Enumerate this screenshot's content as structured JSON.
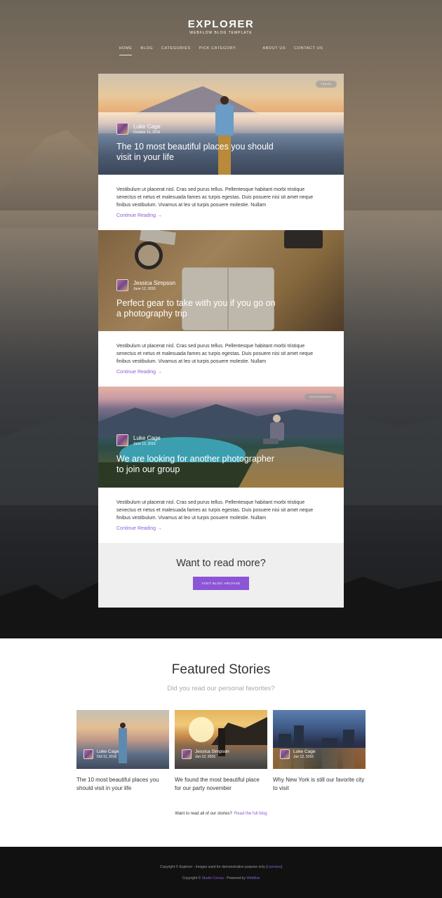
{
  "header": {
    "logo": "EXPLOЯER",
    "tagline": "WEBFLOW BLOG TEMPLATE",
    "nav": [
      "HOME",
      "BLOG",
      "CATEGORIES",
      "PICK CATEGORY",
      "ABOUT US",
      "CONTACT US"
    ]
  },
  "posts": [
    {
      "badge": "TRAVEL",
      "author": "Luke Cage",
      "date": "October 11, 2016",
      "title": "The 10 most beautiful places you should visit in your life",
      "excerpt": "Vestibulum ut placerat nisl. Cras sed purus tellus. Pellentesque habitant morbi tristique senectus et netus et malesuada fames ac turpis egestas. Duis posuere nisi sit amet neque finibus vestibulum. Vivamus at leo ut turpis posuere molestie. Nullam",
      "link": "Continue Reading →"
    },
    {
      "badge": "",
      "author": "Jessica Simpson",
      "date": "June 12, 2016",
      "title": "Perfect gear to take with you if you go on a photography trip",
      "excerpt": "Vestibulum ut placerat nisl. Cras sed purus tellus. Pellentesque habitant morbi tristique senectus et netus et malesuada fames ac turpis egestas. Duis posuere nisi sit amet neque finibus vestibulum. Vivamus at leo ut turpis posuere molestie. Nullam",
      "link": "Continue Reading →"
    },
    {
      "badge": "PHOTOGRAPHY",
      "author": "Luke Cage",
      "date": "June 12, 2016",
      "title": "We are looking for another photographer to join our group",
      "excerpt": "Vestibulum ut placerat nisl. Cras sed purus tellus. Pellentesque habitant morbi tristique senectus et netus et malesuada fames ac turpis egestas. Duis posuere nisi sit amet neque finibus vestibulum. Vivamus at leo ut turpis posuere molestie. Nullam",
      "link": "Continue Reading →"
    }
  ],
  "readmore": {
    "heading": "Want to read more?",
    "button": "VISIT BLOG ARCHIVE"
  },
  "featured": {
    "heading": "Featured Stories",
    "subheading": "Did you read our personal favorites?",
    "cards": [
      {
        "author": "Luke Cage",
        "date": "Oct 11, 2016",
        "title": "The 10 most beautiful places you should visit in your life"
      },
      {
        "author": "Jessica Simpson",
        "date": "Jun 12, 2016",
        "title": "We found the most beautiful place for our party november"
      },
      {
        "author": "Luke Cage",
        "date": "Jun 12, 2016",
        "title": "Why New York is still our favorite city to visit"
      }
    ],
    "cta_text": "Want to read all of our stories?",
    "cta_link": "Read the full blog"
  },
  "footer": {
    "line1_prefix": "Copyright © Explorer  - Images used for demonstration purpose only (",
    "line1_link": "Licenses",
    "line1_suffix": ")",
    "line2_prefix": "Copyright ©",
    "line2_link1": "Studio Corsus",
    "line2_mid": " - Powered by ",
    "line2_link2": "Webflow"
  },
  "colors": {
    "accent": "#8c55d6",
    "footer_bg": "#111111",
    "readmore_bg": "#efefef"
  }
}
